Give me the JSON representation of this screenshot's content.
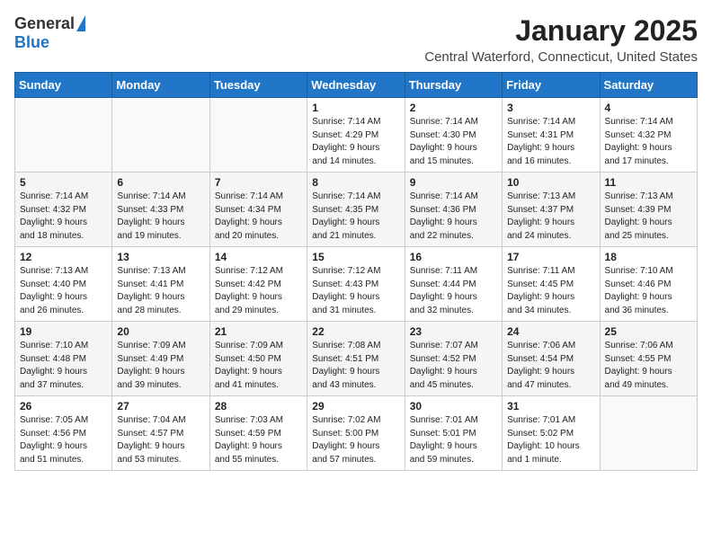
{
  "header": {
    "logo_general": "General",
    "logo_blue": "Blue",
    "month_title": "January 2025",
    "location": "Central Waterford, Connecticut, United States"
  },
  "weekdays": [
    "Sunday",
    "Monday",
    "Tuesday",
    "Wednesday",
    "Thursday",
    "Friday",
    "Saturday"
  ],
  "weeks": [
    [
      {
        "day": "",
        "info": ""
      },
      {
        "day": "",
        "info": ""
      },
      {
        "day": "",
        "info": ""
      },
      {
        "day": "1",
        "info": "Sunrise: 7:14 AM\nSunset: 4:29 PM\nDaylight: 9 hours\nand 14 minutes."
      },
      {
        "day": "2",
        "info": "Sunrise: 7:14 AM\nSunset: 4:30 PM\nDaylight: 9 hours\nand 15 minutes."
      },
      {
        "day": "3",
        "info": "Sunrise: 7:14 AM\nSunset: 4:31 PM\nDaylight: 9 hours\nand 16 minutes."
      },
      {
        "day": "4",
        "info": "Sunrise: 7:14 AM\nSunset: 4:32 PM\nDaylight: 9 hours\nand 17 minutes."
      }
    ],
    [
      {
        "day": "5",
        "info": "Sunrise: 7:14 AM\nSunset: 4:32 PM\nDaylight: 9 hours\nand 18 minutes."
      },
      {
        "day": "6",
        "info": "Sunrise: 7:14 AM\nSunset: 4:33 PM\nDaylight: 9 hours\nand 19 minutes."
      },
      {
        "day": "7",
        "info": "Sunrise: 7:14 AM\nSunset: 4:34 PM\nDaylight: 9 hours\nand 20 minutes."
      },
      {
        "day": "8",
        "info": "Sunrise: 7:14 AM\nSunset: 4:35 PM\nDaylight: 9 hours\nand 21 minutes."
      },
      {
        "day": "9",
        "info": "Sunrise: 7:14 AM\nSunset: 4:36 PM\nDaylight: 9 hours\nand 22 minutes."
      },
      {
        "day": "10",
        "info": "Sunrise: 7:13 AM\nSunset: 4:37 PM\nDaylight: 9 hours\nand 24 minutes."
      },
      {
        "day": "11",
        "info": "Sunrise: 7:13 AM\nSunset: 4:39 PM\nDaylight: 9 hours\nand 25 minutes."
      }
    ],
    [
      {
        "day": "12",
        "info": "Sunrise: 7:13 AM\nSunset: 4:40 PM\nDaylight: 9 hours\nand 26 minutes."
      },
      {
        "day": "13",
        "info": "Sunrise: 7:13 AM\nSunset: 4:41 PM\nDaylight: 9 hours\nand 28 minutes."
      },
      {
        "day": "14",
        "info": "Sunrise: 7:12 AM\nSunset: 4:42 PM\nDaylight: 9 hours\nand 29 minutes."
      },
      {
        "day": "15",
        "info": "Sunrise: 7:12 AM\nSunset: 4:43 PM\nDaylight: 9 hours\nand 31 minutes."
      },
      {
        "day": "16",
        "info": "Sunrise: 7:11 AM\nSunset: 4:44 PM\nDaylight: 9 hours\nand 32 minutes."
      },
      {
        "day": "17",
        "info": "Sunrise: 7:11 AM\nSunset: 4:45 PM\nDaylight: 9 hours\nand 34 minutes."
      },
      {
        "day": "18",
        "info": "Sunrise: 7:10 AM\nSunset: 4:46 PM\nDaylight: 9 hours\nand 36 minutes."
      }
    ],
    [
      {
        "day": "19",
        "info": "Sunrise: 7:10 AM\nSunset: 4:48 PM\nDaylight: 9 hours\nand 37 minutes."
      },
      {
        "day": "20",
        "info": "Sunrise: 7:09 AM\nSunset: 4:49 PM\nDaylight: 9 hours\nand 39 minutes."
      },
      {
        "day": "21",
        "info": "Sunrise: 7:09 AM\nSunset: 4:50 PM\nDaylight: 9 hours\nand 41 minutes."
      },
      {
        "day": "22",
        "info": "Sunrise: 7:08 AM\nSunset: 4:51 PM\nDaylight: 9 hours\nand 43 minutes."
      },
      {
        "day": "23",
        "info": "Sunrise: 7:07 AM\nSunset: 4:52 PM\nDaylight: 9 hours\nand 45 minutes."
      },
      {
        "day": "24",
        "info": "Sunrise: 7:06 AM\nSunset: 4:54 PM\nDaylight: 9 hours\nand 47 minutes."
      },
      {
        "day": "25",
        "info": "Sunrise: 7:06 AM\nSunset: 4:55 PM\nDaylight: 9 hours\nand 49 minutes."
      }
    ],
    [
      {
        "day": "26",
        "info": "Sunrise: 7:05 AM\nSunset: 4:56 PM\nDaylight: 9 hours\nand 51 minutes."
      },
      {
        "day": "27",
        "info": "Sunrise: 7:04 AM\nSunset: 4:57 PM\nDaylight: 9 hours\nand 53 minutes."
      },
      {
        "day": "28",
        "info": "Sunrise: 7:03 AM\nSunset: 4:59 PM\nDaylight: 9 hours\nand 55 minutes."
      },
      {
        "day": "29",
        "info": "Sunrise: 7:02 AM\nSunset: 5:00 PM\nDaylight: 9 hours\nand 57 minutes."
      },
      {
        "day": "30",
        "info": "Sunrise: 7:01 AM\nSunset: 5:01 PM\nDaylight: 9 hours\nand 59 minutes."
      },
      {
        "day": "31",
        "info": "Sunrise: 7:01 AM\nSunset: 5:02 PM\nDaylight: 10 hours\nand 1 minute."
      },
      {
        "day": "",
        "info": ""
      }
    ]
  ]
}
